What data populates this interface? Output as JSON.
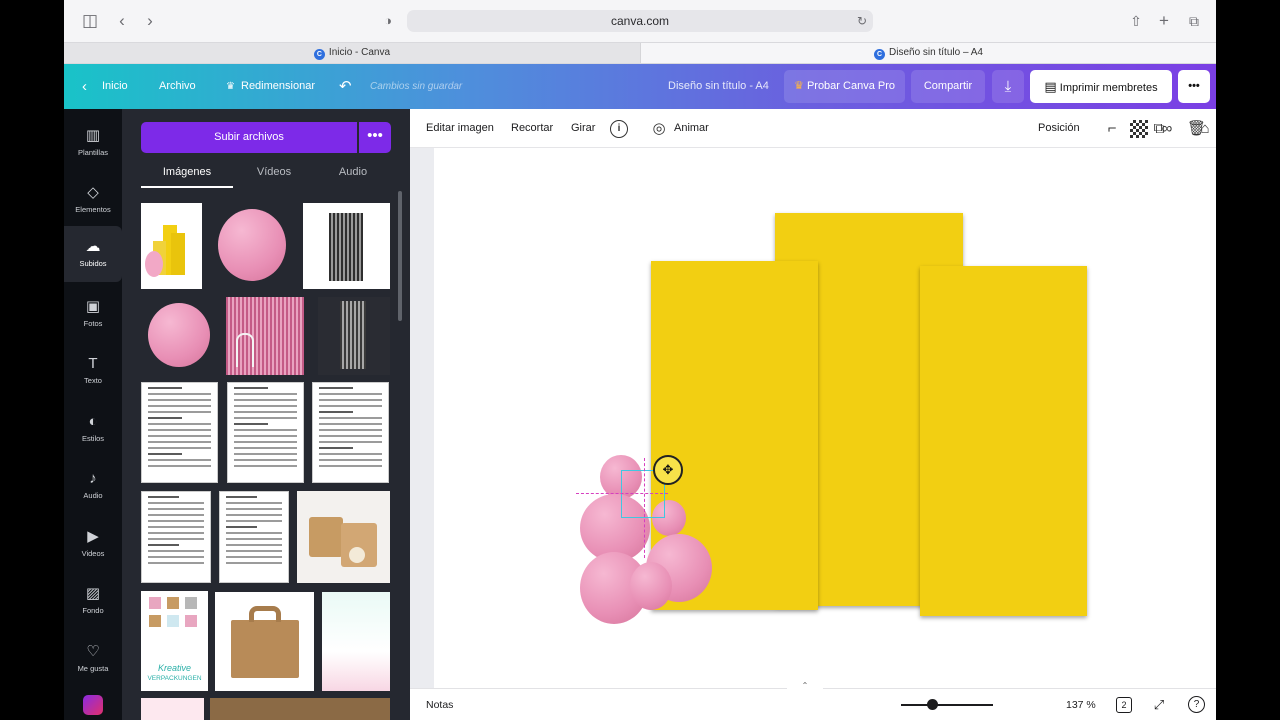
{
  "safari": {
    "url": "canva.com"
  },
  "browser_tabs": [
    {
      "label": "Inicio - Canva"
    },
    {
      "label": "Diseño sin título – A4"
    }
  ],
  "header": {
    "back_label": "Inicio",
    "file_label": "Archivo",
    "resize_label": "Redimensionar",
    "unsaved_label": "Cambios sin guardar",
    "doc_title": "Diseño sin título - A4",
    "try_pro_label": "Probar Canva Pro",
    "share_label": "Compartir",
    "print_label": "Imprimir membretes",
    "more_label": "•••"
  },
  "nav": {
    "items": [
      {
        "label": "Plantillas",
        "icon": "templates-icon",
        "glyph": "▥"
      },
      {
        "label": "Elementos",
        "icon": "elements-icon",
        "glyph": "◇"
      },
      {
        "label": "Subidos",
        "icon": "upload-cloud-icon",
        "glyph": "☁"
      },
      {
        "label": "Fotos",
        "icon": "photos-icon",
        "glyph": "▣"
      },
      {
        "label": "Texto",
        "icon": "text-icon",
        "glyph": "T"
      },
      {
        "label": "Estilos",
        "icon": "palette-icon",
        "glyph": "◐"
      },
      {
        "label": "Audio",
        "icon": "music-note-icon",
        "glyph": "♪"
      },
      {
        "label": "Videos",
        "icon": "video-icon",
        "glyph": "▶"
      },
      {
        "label": "Fondo",
        "icon": "background-pattern-icon",
        "glyph": "▨"
      },
      {
        "label": "Me gusta",
        "icon": "heart-icon",
        "glyph": "♡"
      }
    ]
  },
  "panel": {
    "upload_label": "Subir archivos",
    "more_label": "•••",
    "tabs": [
      {
        "label": "Imágenes"
      },
      {
        "label": "Vídeos"
      },
      {
        "label": "Audio"
      }
    ],
    "thumb_text": {
      "krea_title": "Kreative",
      "krea_sub": "VERPACKUNGEN"
    }
  },
  "toolbar": {
    "edit_image": "Editar imagen",
    "crop": "Recortar",
    "rotate": "Girar",
    "animate": "Animar",
    "position": "Posición"
  },
  "footer": {
    "notes": "Notas",
    "zoom": "137 %",
    "pages": "2",
    "zoom_fraction": 0.34
  },
  "colors": {
    "accent_purple": "#7d2ae8",
    "panel_yellow": "#f2cf12",
    "balloon_pink": "#e88fb5"
  }
}
